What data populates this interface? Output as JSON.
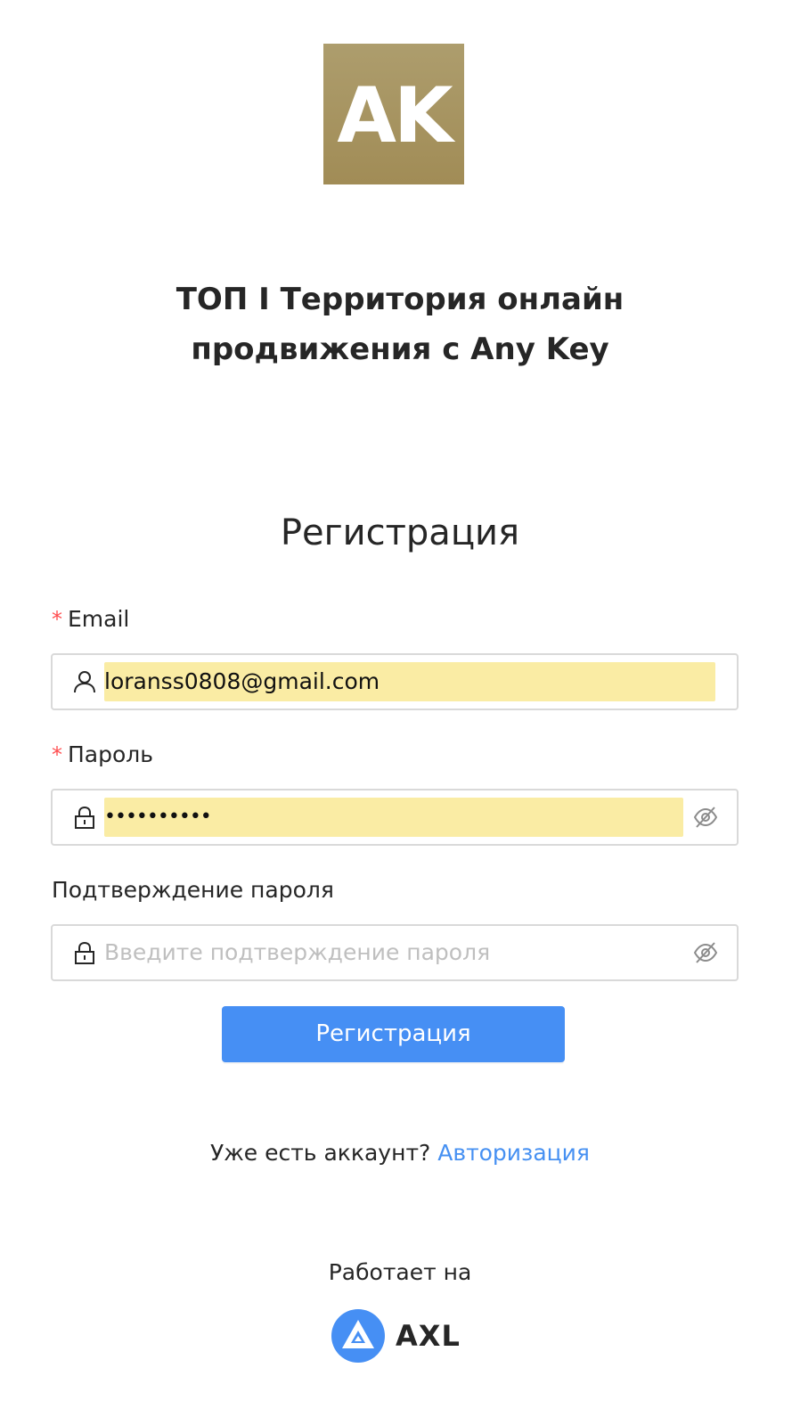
{
  "logo": {
    "text": "AK",
    "bg_color": "#a8976a"
  },
  "org_title": {
    "line1": "ТОП I Территория онлайн",
    "line2": "продвижения с Any Key"
  },
  "form": {
    "title": "Регистрация",
    "email": {
      "required_mark": "*",
      "label": "Email",
      "value": "loranss0808@gmail.com",
      "prefix_icon": "user-icon"
    },
    "password": {
      "required_mark": "*",
      "label": "Пароль",
      "value": "••••••••••",
      "prefix_icon": "lock-icon",
      "suffix_icon": "eye-invisible-icon"
    },
    "confirm_password": {
      "label": "Подтверждение пароля",
      "placeholder": "Введите подтверждение пароля",
      "prefix_icon": "lock-icon",
      "suffix_icon": "eye-invisible-icon"
    },
    "submit_label": "Регистрация"
  },
  "login_prompt": {
    "text": "Уже есть аккаунт?",
    "link": "Авторизация"
  },
  "footer": {
    "powered_by": "Работает на",
    "brand_name": "AXL"
  },
  "colors": {
    "accent": "#468ff4",
    "link": "#4690f2",
    "required": "#ff4d4f",
    "autofill": "#faeca4"
  }
}
